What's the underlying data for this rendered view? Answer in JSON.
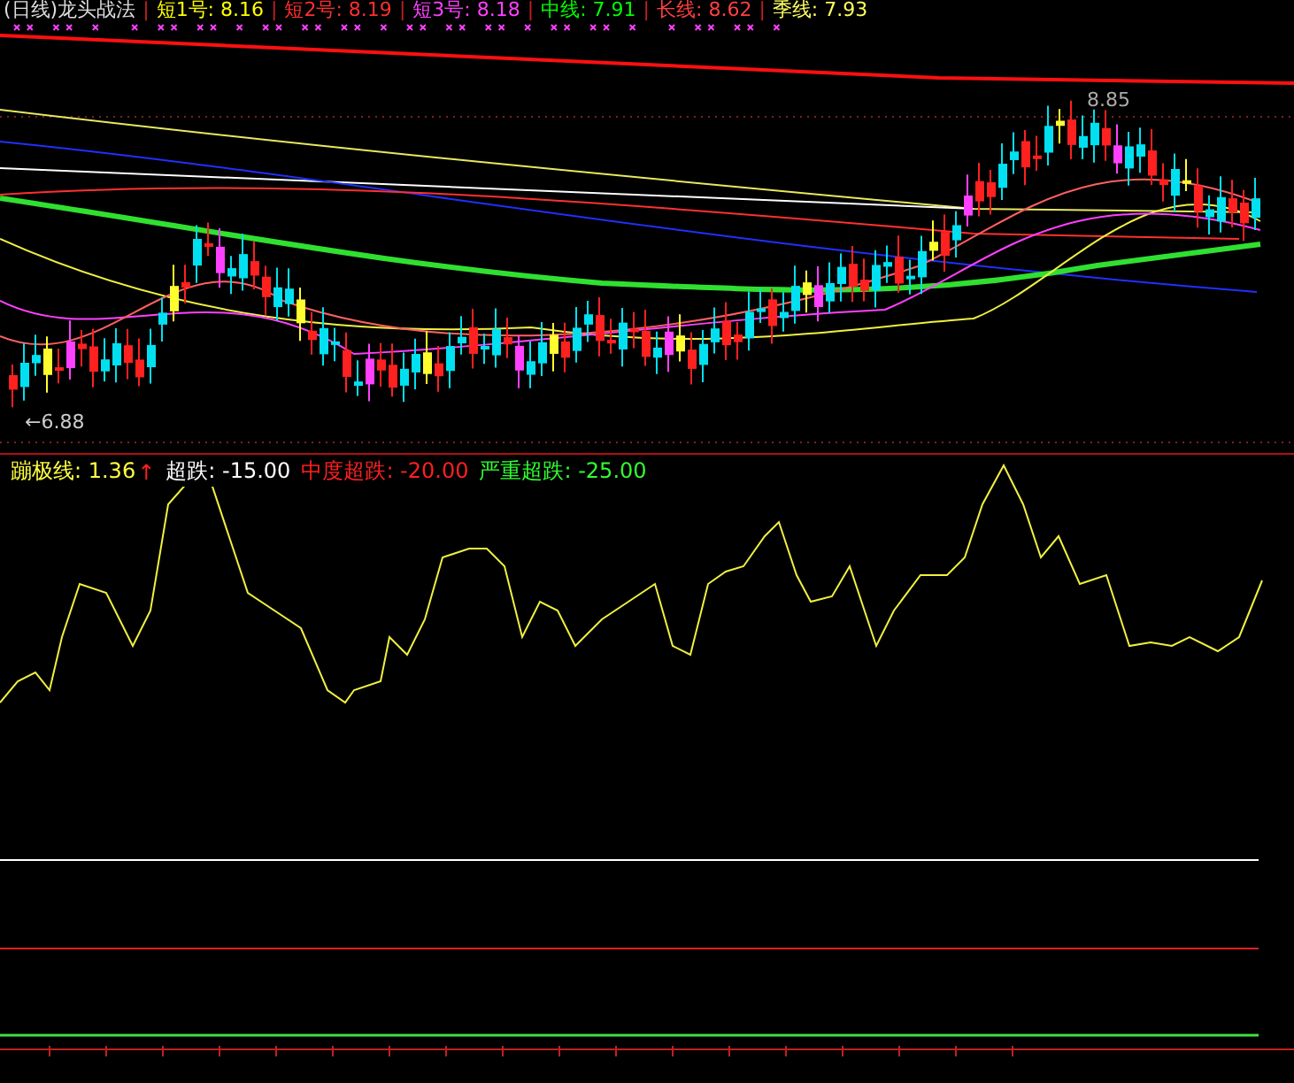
{
  "main_pane": {
    "title": "(日线)龙头战法",
    "legend": [
      {
        "separator": "|",
        "text": "短1号: 8.16",
        "color": "#ffff00"
      },
      {
        "separator": "|",
        "text": "短2号: 8.19",
        "color": "#ff3030"
      },
      {
        "separator": "|",
        "text": "短3号: 8.18",
        "color": "#ff40ff"
      },
      {
        "separator": "|",
        "text": "中线: 7.91",
        "color": "#00ff00"
      },
      {
        "separator": "|",
        "text": "长线: 8.62",
        "color": "#ff4040"
      },
      {
        "separator": "|",
        "text": "季线: 7.93",
        "color": "#ffff60"
      }
    ],
    "high_label": "8.85",
    "low_label": "←6.88"
  },
  "indicator_pane": {
    "legend": [
      {
        "text": "蹦极线: 1.36",
        "color": "#ffff40",
        "suffix": "↑"
      },
      {
        "text": "超跌: -15.00",
        "color": "#ffffff"
      },
      {
        "text": "中度超跌: -20.00",
        "color": "#ff2020"
      },
      {
        "text": "严重超跌: -25.00",
        "color": "#30ff30"
      }
    ]
  }
}
